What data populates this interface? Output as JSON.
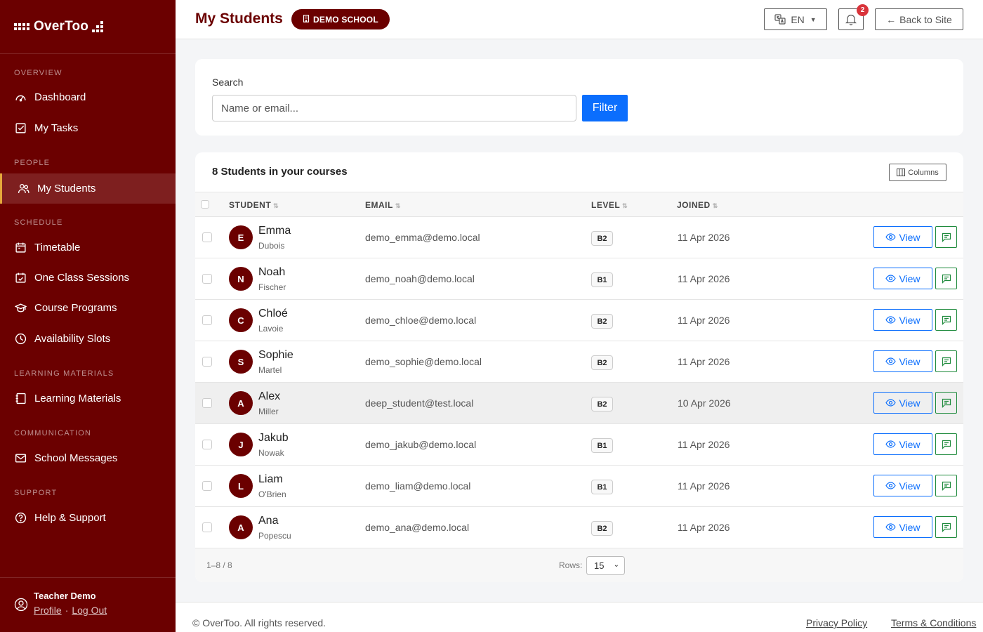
{
  "brand": {
    "name": "OverToo"
  },
  "sidebar": {
    "sections": {
      "overview": "OVERVIEW",
      "people": "PEOPLE",
      "schedule": "SCHEDULE",
      "learning": "LEARNING MATERIALS",
      "communication": "COMMUNICATION",
      "support": "SUPPORT"
    },
    "items": {
      "dashboard": "Dashboard",
      "tasks": "My Tasks",
      "students": "My Students",
      "timetable": "Timetable",
      "one_class": "One Class Sessions",
      "programs": "Course Programs",
      "availability": "Availability Slots",
      "materials": "Learning Materials",
      "messages": "School Messages",
      "help": "Help & Support"
    },
    "active_item": "My Students",
    "user": {
      "name": "Teacher Demo",
      "profile": "Profile",
      "separator": "·",
      "logout": "Log Out"
    }
  },
  "header": {
    "title": "My Students",
    "school_badge": "DEMO SCHOOL",
    "language": "EN",
    "notifications": "2",
    "back": "Back to Site"
  },
  "search": {
    "label": "Search",
    "placeholder": "Name or email...",
    "value": "",
    "button": "Filter"
  },
  "table": {
    "title": "8 Students in your courses",
    "columns_button": "Columns",
    "headers": {
      "student": "STUDENT",
      "email": "EMAIL",
      "level": "LEVEL",
      "joined": "JOINED"
    },
    "sort_glyph": "⇅",
    "view_label": "View",
    "highlighted_row": 4,
    "rows": [
      {
        "initial": "E",
        "first": "Emma",
        "last": "Dubois",
        "email": "demo_emma@demo.local",
        "level": "B2",
        "joined": "11 Apr 2026"
      },
      {
        "initial": "N",
        "first": "Noah",
        "last": "Fischer",
        "email": "demo_noah@demo.local",
        "level": "B1",
        "joined": "11 Apr 2026"
      },
      {
        "initial": "C",
        "first": "Chloé",
        "last": "Lavoie",
        "email": "demo_chloe@demo.local",
        "level": "B2",
        "joined": "11 Apr 2026"
      },
      {
        "initial": "S",
        "first": "Sophie",
        "last": "Martel",
        "email": "demo_sophie@demo.local",
        "level": "B2",
        "joined": "11 Apr 2026"
      },
      {
        "initial": "A",
        "first": "Alex",
        "last": "Miller",
        "email": "deep_student@test.local",
        "level": "B2",
        "joined": "10 Apr 2026"
      },
      {
        "initial": "J",
        "first": "Jakub",
        "last": "Nowak",
        "email": "demo_jakub@demo.local",
        "level": "B1",
        "joined": "11 Apr 2026"
      },
      {
        "initial": "L",
        "first": "Liam",
        "last": "O'Brien",
        "email": "demo_liam@demo.local",
        "level": "B1",
        "joined": "11 Apr 2026"
      },
      {
        "initial": "A",
        "first": "Ana",
        "last": "Popescu",
        "email": "demo_ana@demo.local",
        "level": "B2",
        "joined": "11 Apr 2026"
      }
    ],
    "footer": {
      "range": "1–8 / 8",
      "rows_label": "Rows:",
      "rows_value": "15"
    }
  },
  "footer": {
    "copyright": "© OverToo. All rights reserved.",
    "privacy": "Privacy Policy",
    "terms": "Terms & Conditions"
  },
  "colors": {
    "brand": "#6b0000",
    "accent_blue": "#0b6efd",
    "accent_green": "#1e8a3c",
    "active_marker": "#e5a83b",
    "badge_red": "#d9343b"
  }
}
